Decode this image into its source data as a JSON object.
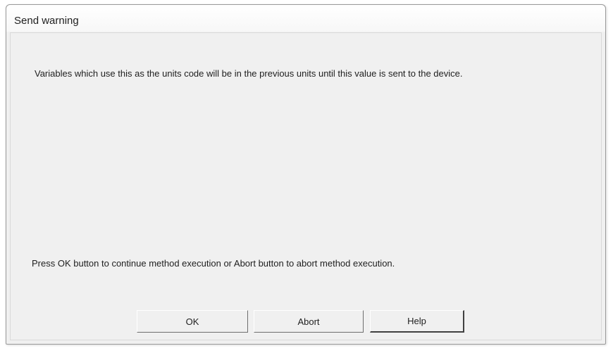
{
  "window": {
    "title": "Send warning"
  },
  "dialog": {
    "message": "Variables which use this as the units code will be in the previous units until this value is sent to the device.",
    "instruction": "Press OK button to continue method execution or Abort button to abort method execution."
  },
  "buttons": {
    "ok_label": "OK",
    "abort_label": "Abort",
    "help_label": "Help"
  },
  "colors": {
    "dialog_background": "#f0f0f0",
    "text": "#1e1e1e"
  }
}
